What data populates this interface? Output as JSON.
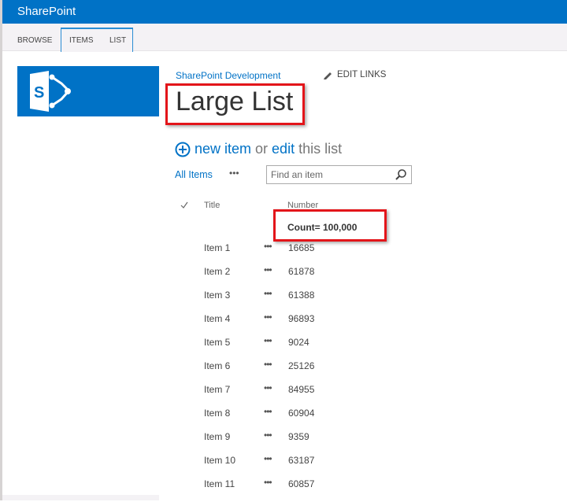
{
  "app": {
    "brand": "SharePoint"
  },
  "ribbon": {
    "tabs": [
      "BROWSE",
      "ITEMS",
      "LIST"
    ]
  },
  "breadcrumb": "SharePoint Development",
  "edit_links": "EDIT LINKS",
  "page_title": "Large List",
  "new_item": {
    "new": "new item",
    "or": "or",
    "edit": "edit",
    "rest": "this list"
  },
  "view": {
    "name": "All Items",
    "more": "•••"
  },
  "search": {
    "placeholder": "Find an item"
  },
  "columns": {
    "title": "Title",
    "number": "Number"
  },
  "aggregate": {
    "count": "Count= 100,000"
  },
  "rows": [
    {
      "title": "Item 1",
      "number": "16685"
    },
    {
      "title": "Item 2",
      "number": "61878"
    },
    {
      "title": "Item 3",
      "number": "61388"
    },
    {
      "title": "Item 4",
      "number": "96893"
    },
    {
      "title": "Item 5",
      "number": "9024"
    },
    {
      "title": "Item 6",
      "number": "25126"
    },
    {
      "title": "Item 7",
      "number": "84955"
    },
    {
      "title": "Item 8",
      "number": "60904"
    },
    {
      "title": "Item 9",
      "number": "9359"
    },
    {
      "title": "Item 10",
      "number": "63187"
    },
    {
      "title": "Item 11",
      "number": "60857"
    }
  ],
  "row_menu": "•••",
  "colors": {
    "brand": "#0072c6",
    "highlight": "#e3151a"
  }
}
